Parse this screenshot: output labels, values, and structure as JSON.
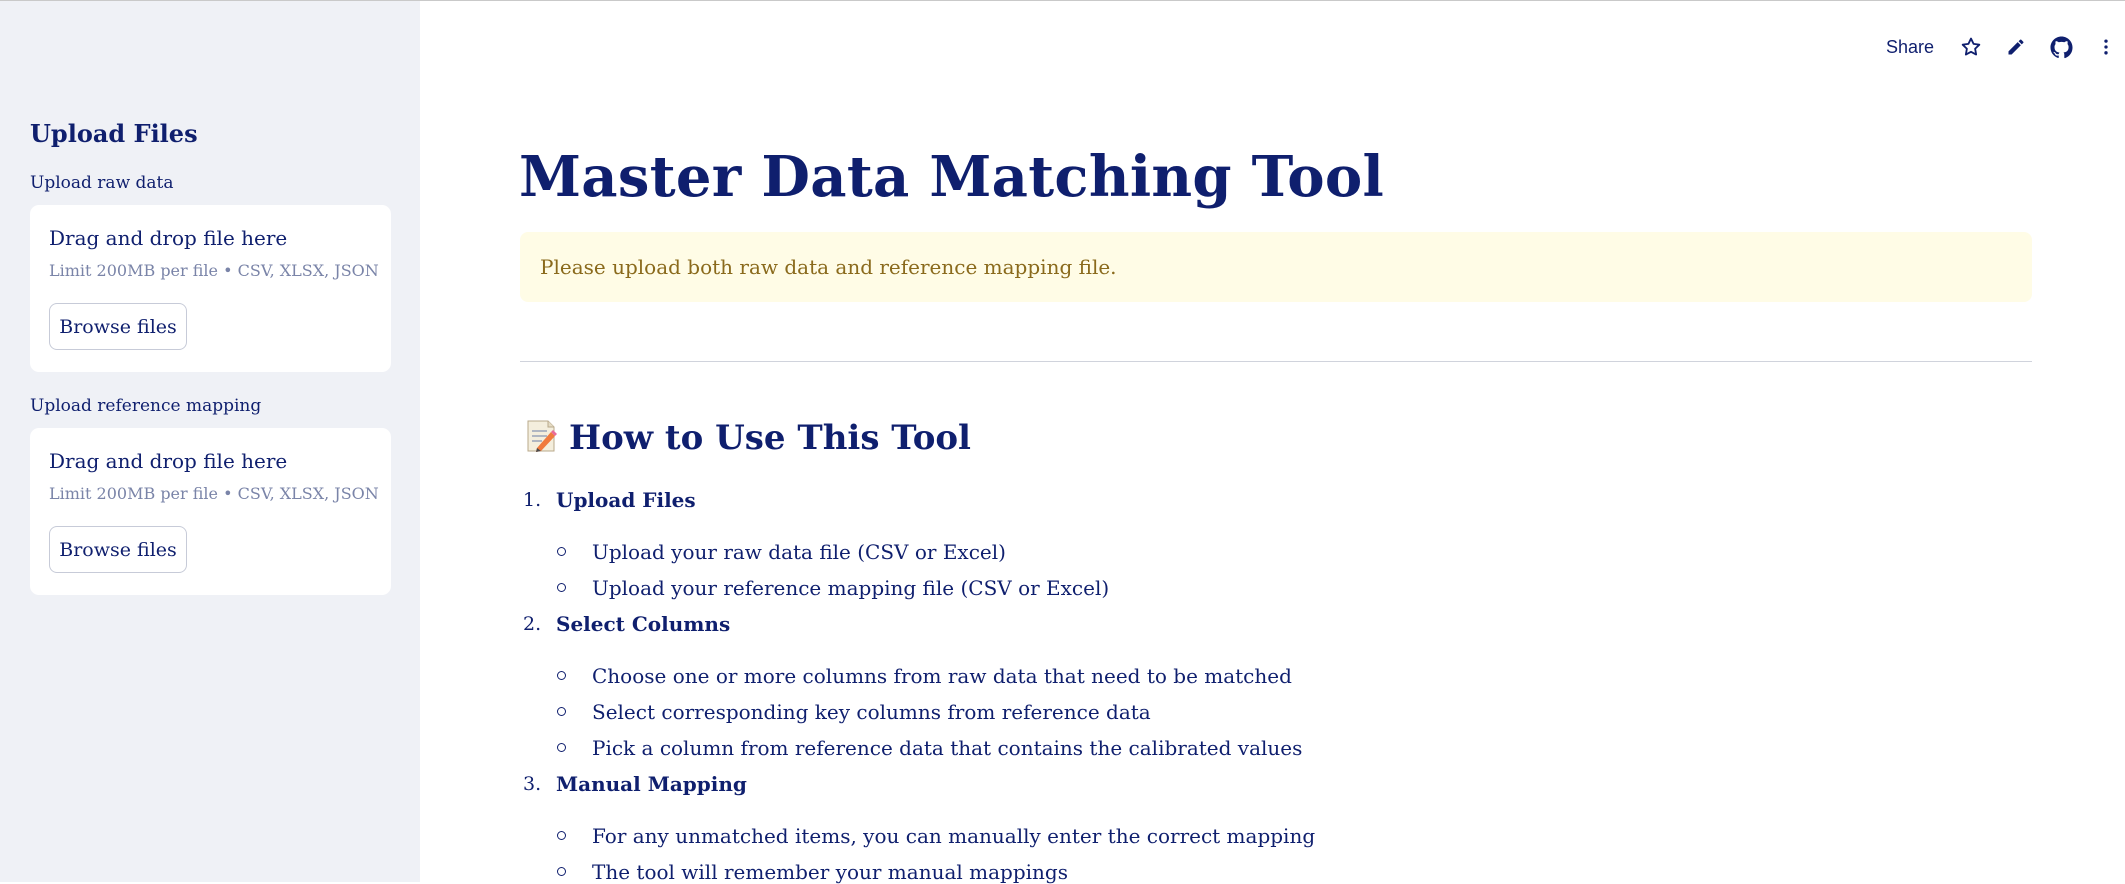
{
  "sidebar": {
    "title": "Upload Files",
    "uploaders": [
      {
        "label": "Upload raw data",
        "drop_text": "Drag and drop file here",
        "limit_text": "Limit 200MB per file • CSV, XLSX, JSON",
        "button_label": "Browse files"
      },
      {
        "label": "Upload reference mapping",
        "drop_text": "Drag and drop file here",
        "limit_text": "Limit 200MB per file • CSV, XLSX, JSON",
        "button_label": "Browse files"
      }
    ]
  },
  "toolbar": {
    "share_label": "Share",
    "icons": [
      "star-icon",
      "pencil-icon",
      "github-icon",
      "more-vertical-icon"
    ]
  },
  "main": {
    "title": "Master Data Matching Tool",
    "alert": "Please upload both raw data and reference mapping file.",
    "howto": {
      "emoji": "📝",
      "heading": "How to Use This Tool",
      "steps": [
        {
          "number": "1.",
          "title": "Upload Files",
          "items": [
            "Upload your raw data file (CSV or Excel)",
            "Upload your reference mapping file (CSV or Excel)"
          ]
        },
        {
          "number": "2.",
          "title": "Select Columns",
          "items": [
            "Choose one or more columns from raw data that need to be matched",
            "Select corresponding key columns from reference data",
            "Pick a column from reference data that contains the calibrated values"
          ]
        },
        {
          "number": "3.",
          "title": "Manual Mapping",
          "items": [
            "For any unmatched items, you can manually enter the correct mapping",
            "The tool will remember your manual mappings"
          ]
        }
      ]
    }
  },
  "colors": {
    "primary_text": "#0f1f6e",
    "sidebar_bg": "#eff1f6",
    "alert_bg": "#fffce6",
    "alert_text": "#8a6a1c"
  }
}
